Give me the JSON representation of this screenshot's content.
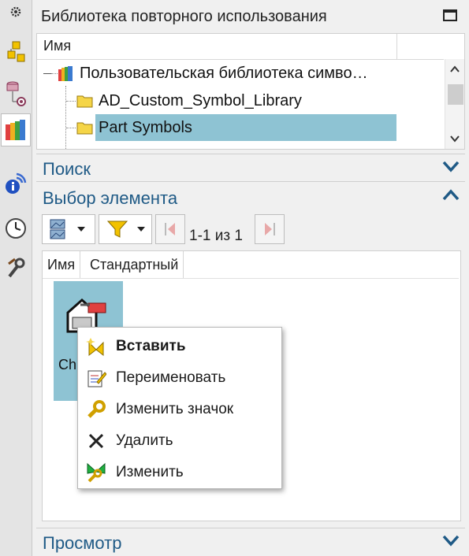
{
  "panel_title": "Библиотека повторного использования",
  "tree": {
    "column_header": "Имя",
    "rows": [
      {
        "label": "Пользовательская библиотека симво…"
      },
      {
        "label": "AD_Custom_Symbol_Library"
      },
      {
        "label": "Part Symbols",
        "selected": true
      },
      {
        "label": "…"
      }
    ]
  },
  "sections": {
    "search": "Поиск",
    "member_select": "Выбор элемента",
    "preview": "Просмотр"
  },
  "toolbar": {
    "pager": "1-1 из 1"
  },
  "grid": {
    "columns": [
      "Имя",
      "Стандартный"
    ],
    "item_label": "Ch"
  },
  "context_menu": {
    "items": [
      {
        "label": "Вставить",
        "bold": true,
        "icon": "insert-icon"
      },
      {
        "label": "Переименовать",
        "icon": "rename-icon"
      },
      {
        "label": "Изменить значок",
        "icon": "wrench-icon"
      },
      {
        "label": "Удалить",
        "icon": "delete-x-icon"
      },
      {
        "label": "Изменить",
        "icon": "edit-icon"
      }
    ]
  },
  "colors": {
    "selection": "#8ec3d3",
    "section_text": "#1f5a86"
  }
}
